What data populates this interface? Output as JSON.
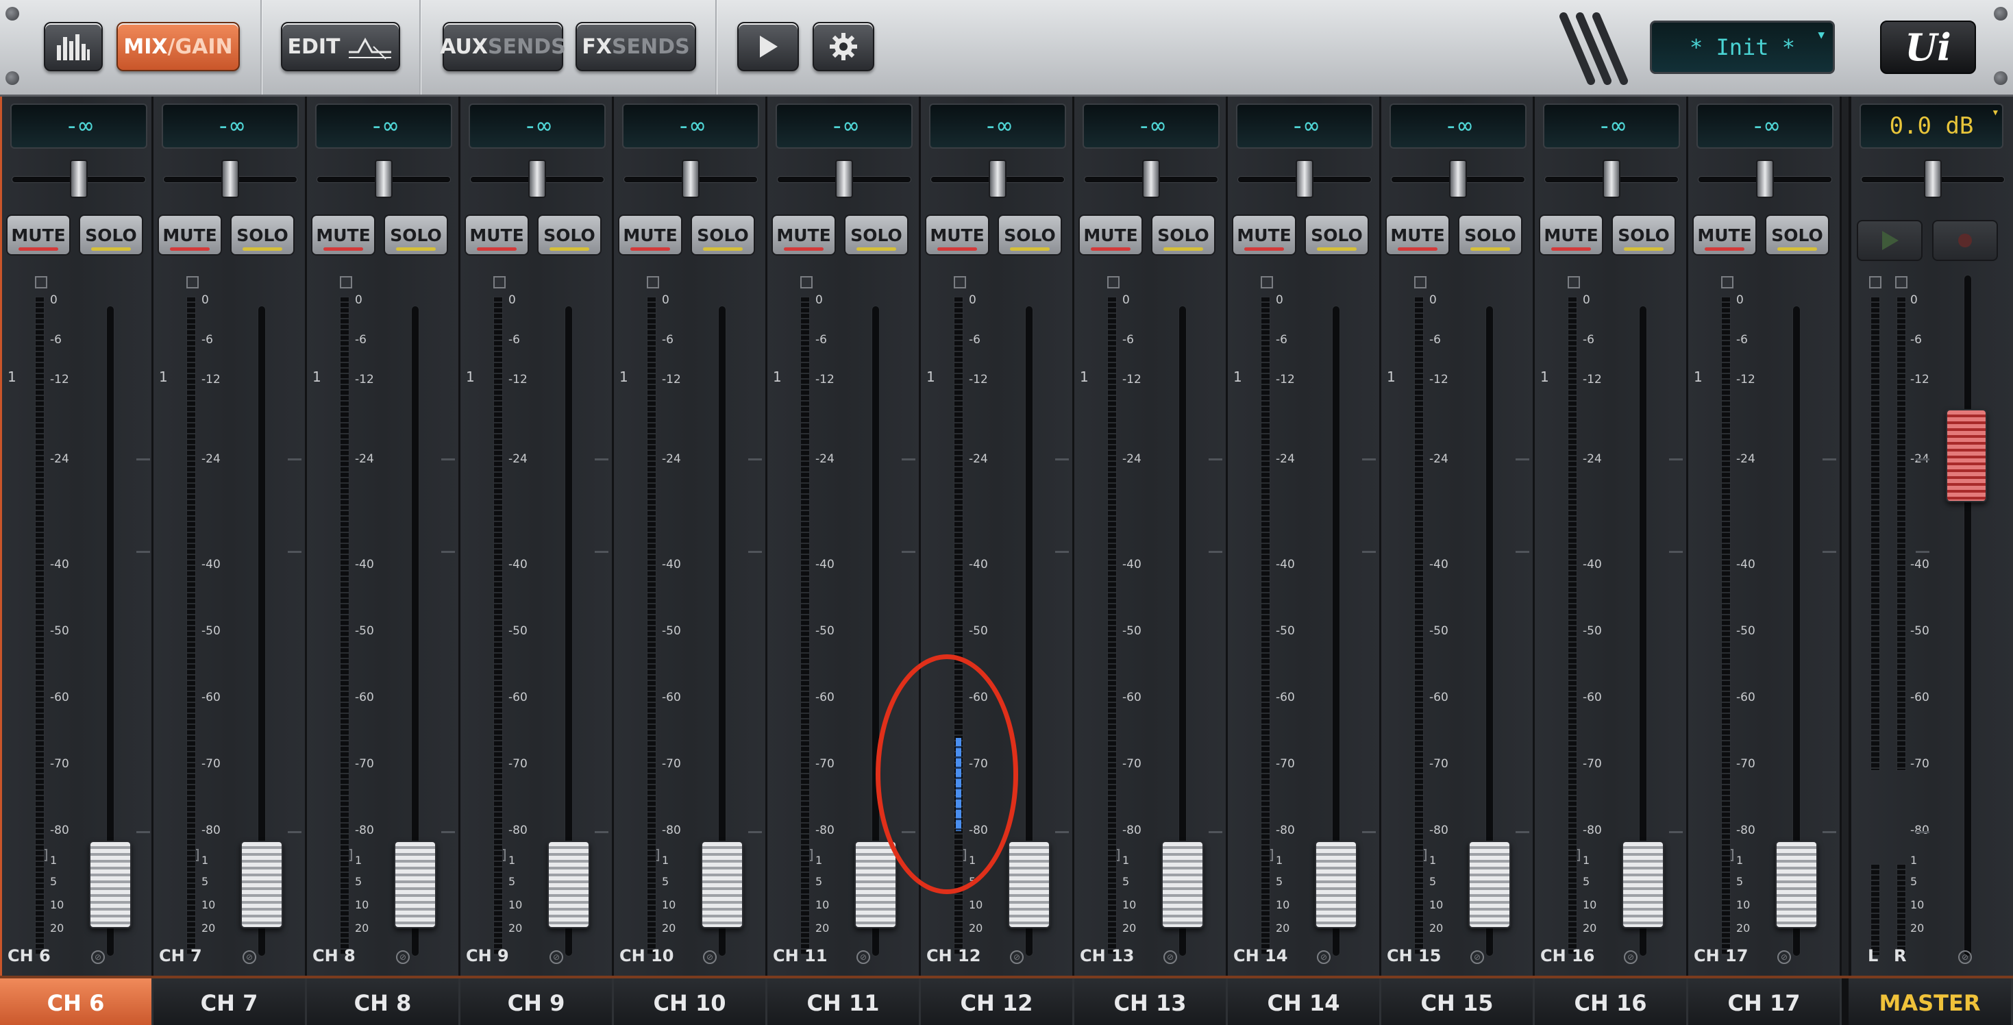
{
  "toolbar": {
    "meters_label": "meters",
    "mix_label": "MIX",
    "gain_label": "/GAIN",
    "edit_label": "EDIT",
    "aux_label": "AUX",
    "aux_sends_label": "SENDS",
    "fx_label": "FX",
    "fx_sends_label": "SENDS",
    "preset_name": "* Init *",
    "logo_text": "Ui"
  },
  "strips": [
    {
      "name": "CH 6",
      "level": "-∞"
    },
    {
      "name": "CH 7",
      "level": "-∞"
    },
    {
      "name": "CH 8",
      "level": "-∞"
    },
    {
      "name": "CH 9",
      "level": "-∞"
    },
    {
      "name": "CH 10",
      "level": "-∞"
    },
    {
      "name": "CH 11",
      "level": "-∞"
    },
    {
      "name": "CH 12",
      "level": "-∞",
      "meter_signal_range_db": [
        -80,
        -66
      ]
    },
    {
      "name": "CH 13",
      "level": "-∞"
    },
    {
      "name": "CH 14",
      "level": "-∞"
    },
    {
      "name": "CH 15",
      "level": "-∞"
    },
    {
      "name": "CH 16",
      "level": "-∞"
    },
    {
      "name": "CH 17",
      "level": "-∞"
    }
  ],
  "master": {
    "name": "MASTER",
    "level": "0.0 dB",
    "left_label": "L",
    "right_label": "R"
  },
  "labels": {
    "mute": "MUTE",
    "solo": "SOLO",
    "gain_marker": "1"
  },
  "meter_scale": [
    "0",
    "-6",
    "-12",
    "-24",
    "-40",
    "-50",
    "-60",
    "-70",
    "-80"
  ],
  "gain_scale": [
    "1",
    "5",
    "10",
    "20"
  ],
  "tabs": [
    "CH 6",
    "CH 7",
    "CH 8",
    "CH 9",
    "CH 10",
    "CH 11",
    "CH 12",
    "CH 13",
    "CH 14",
    "CH 15",
    "CH 16",
    "CH 17",
    "MASTER"
  ],
  "active_tab": "CH 6",
  "colors": {
    "accent": "#d9683a",
    "display_text": "#4fd4d4",
    "master_text": "#f0c23a",
    "mute_led": "#d33a3a",
    "solo_led": "#d6c03a",
    "meter_signal": "#3b7ad8",
    "highlight": "#e0301a"
  }
}
